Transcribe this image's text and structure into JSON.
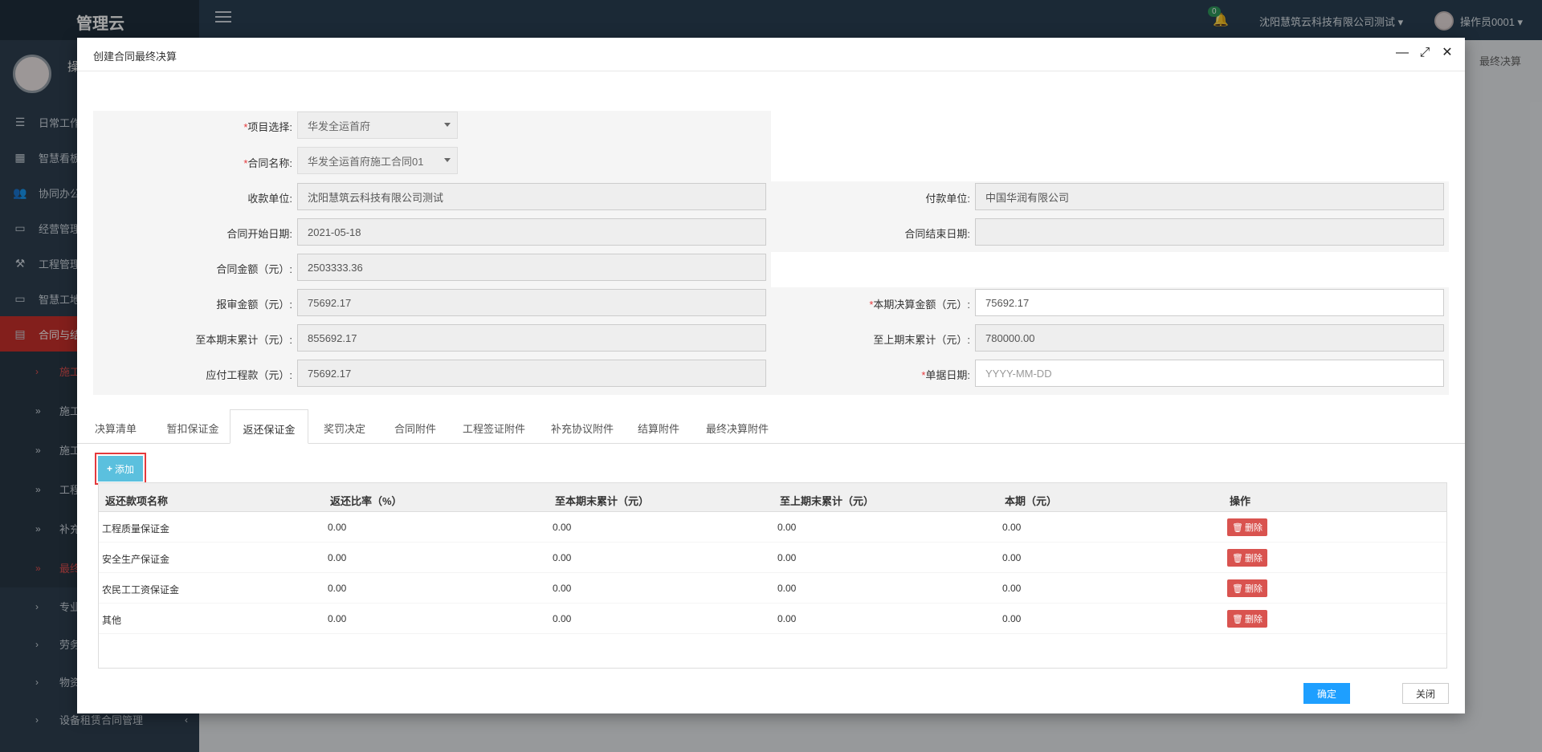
{
  "app": {
    "brand": "管理云",
    "notification_count": "0",
    "company": "沈阳慧筑云科技有限公司测试 ▾",
    "user": "操作员0001 ▾",
    "breadcrumb_tail": "最终决算",
    "profile_initial": "操"
  },
  "sidebar": {
    "items": [
      {
        "label": "日常工作",
        "icon": "list-icon"
      },
      {
        "label": "智慧看板",
        "icon": "dashboard-icon"
      },
      {
        "label": "协同办公",
        "icon": "users-icon"
      },
      {
        "label": "经营管理",
        "icon": "monitor-icon"
      },
      {
        "label": "工程管理",
        "icon": "hammer-icon"
      },
      {
        "label": "智慧工地",
        "icon": "monitor-icon"
      },
      {
        "label": "合同与结算",
        "icon": "document-icon"
      }
    ],
    "subitems": [
      "施工",
      "施工",
      "施工",
      "工程",
      "补充",
      "最终"
    ],
    "more": [
      "专业",
      "劳务",
      "物资",
      "设备租赁合同管理"
    ]
  },
  "modal": {
    "title": "创建合同最终决算",
    "fields": {
      "project_label": "项目选择:",
      "project_value": "华发全运首府",
      "contract_label": "合同名称:",
      "contract_value": "华发全运首府施工合同01",
      "payee_label": "收款单位:",
      "payee_value": "沈阳慧筑云科技有限公司测试",
      "payer_label": "付款单位:",
      "payer_value": "中国华润有限公司",
      "start_label": "合同开始日期:",
      "start_value": "2021-05-18",
      "end_label": "合同结束日期:",
      "end_value": "",
      "amount_label": "合同金额（元）:",
      "amount_value": "2503333.36",
      "review_label": "报审金额（元）:",
      "review_value": "75692.17",
      "current_settle_label": "本期决算金额（元）:",
      "current_settle_value": "75692.17",
      "cum_label": "至本期末累计（元）:",
      "cum_value": "855692.17",
      "prev_cum_label": "至上期末累计（元）:",
      "prev_cum_value": "780000.00",
      "payable_label": "应付工程款（元）:",
      "payable_value": "75692.17",
      "doc_date_label": "单据日期:",
      "doc_date_placeholder": "YYYY-MM-DD"
    },
    "tabs": [
      "决算清单",
      "暂扣保证金",
      "返还保证金",
      "奖罚决定",
      "合同附件",
      "工程签证附件",
      "补充协议附件",
      "结算附件",
      "最终决算附件"
    ],
    "active_tab": "返还保证金",
    "add_label": "添加",
    "table": {
      "headers": [
        "返还款项名称",
        "返还比率（%）",
        "至本期末累计（元）",
        "至上期末累计（元）",
        "本期（元）",
        "操作"
      ],
      "delete_label": "删除",
      "rows": [
        [
          "工程质量保证金",
          "0.00",
          "0.00",
          "0.00",
          "0.00"
        ],
        [
          "安全生产保证金",
          "0.00",
          "0.00",
          "0.00",
          "0.00"
        ],
        [
          "农民工工资保证金",
          "0.00",
          "0.00",
          "0.00",
          "0.00"
        ],
        [
          "其他",
          "0.00",
          "0.00",
          "0.00",
          "0.00"
        ]
      ]
    },
    "ok_label": "确定",
    "close_label": "关闭"
  },
  "colors": {
    "topbar": "#2a3f54",
    "sidebar": "#2f4050",
    "active_menu": "#c9302c",
    "add_button": "#5bc0de",
    "delete_button": "#d9534f",
    "ok_button": "#1e9fff"
  }
}
